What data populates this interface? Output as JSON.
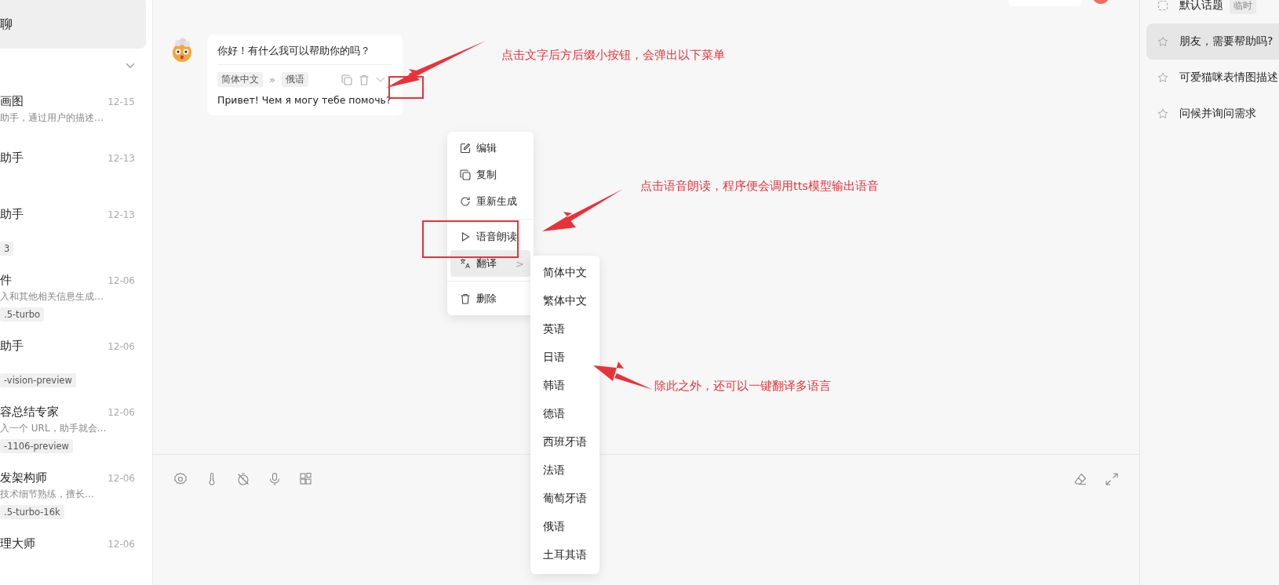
{
  "sidebar": {
    "active_session": {
      "title": "聊",
      "selected": true
    },
    "section": {
      "expanded": true
    },
    "assistants": [
      {
        "title": "画图",
        "date": "12-15",
        "description": "助手，通过用户的描述…"
      },
      {
        "title": "助手",
        "date": "12-13"
      },
      {
        "title": "助手",
        "date": "12-13",
        "tag": "3"
      },
      {
        "title": "件",
        "date": "12-06",
        "description": "入和其他相关信息生成…",
        "tag": ".5-turbo"
      },
      {
        "title": "助手",
        "date": "12-06",
        "tag": "-vision-preview"
      },
      {
        "title": "容总结专家",
        "date": "12-06",
        "description": "入一个 URL，助手就会…",
        "tag": "-1106-preview"
      },
      {
        "title": "发架构师",
        "date": "12-06",
        "description": "技术细节熟练，擅长…",
        "tag": ".5-turbo-16k"
      },
      {
        "title": "理大师",
        "date": "12-06"
      }
    ]
  },
  "chat": {
    "message": {
      "text": "你好！有什么我可以帮助你的吗？",
      "translation": {
        "from": "简体中文",
        "separator": "»",
        "to": "俄语",
        "text": "Привет! Чем я могу тебе помочь?"
      }
    },
    "context_menu": [
      {
        "kind": "item",
        "label": "编辑",
        "selected": false
      },
      {
        "kind": "item",
        "label": "复制",
        "selected": false
      },
      {
        "kind": "item",
        "label": "重新生成",
        "selected": false
      },
      {
        "kind": "divider"
      },
      {
        "kind": "item",
        "label": "语音朗读",
        "selected": false
      },
      {
        "kind": "submenu",
        "label": "翻译",
        "selected": true,
        "arrow": ">"
      },
      {
        "kind": "divider"
      },
      {
        "kind": "item",
        "label": "删除",
        "selected": false
      }
    ],
    "translate_submenu": [
      "简体中文",
      "繁体中文",
      "英语",
      "日语",
      "韩语",
      "德语",
      "西班牙语",
      "法语",
      "葡萄牙语",
      "俄语",
      "土耳其语"
    ]
  },
  "annotations": [
    "点击文字后方后缀小按钮，会弹出以下菜单",
    "点击语音朗读，程序便会调用tts模型输出语音",
    "除此之外，还可以一键翻译多语言"
  ],
  "topics": [
    {
      "kind": "default",
      "title": "默认话题",
      "tag": "临时",
      "selected": false
    },
    {
      "kind": "saved",
      "title": "朋友，需要帮助吗?",
      "selected": true
    },
    {
      "kind": "saved",
      "title": "可爱猫咪表情图描述",
      "selected": false
    },
    {
      "kind": "saved",
      "title": "问候并询问需求",
      "selected": false
    }
  ]
}
